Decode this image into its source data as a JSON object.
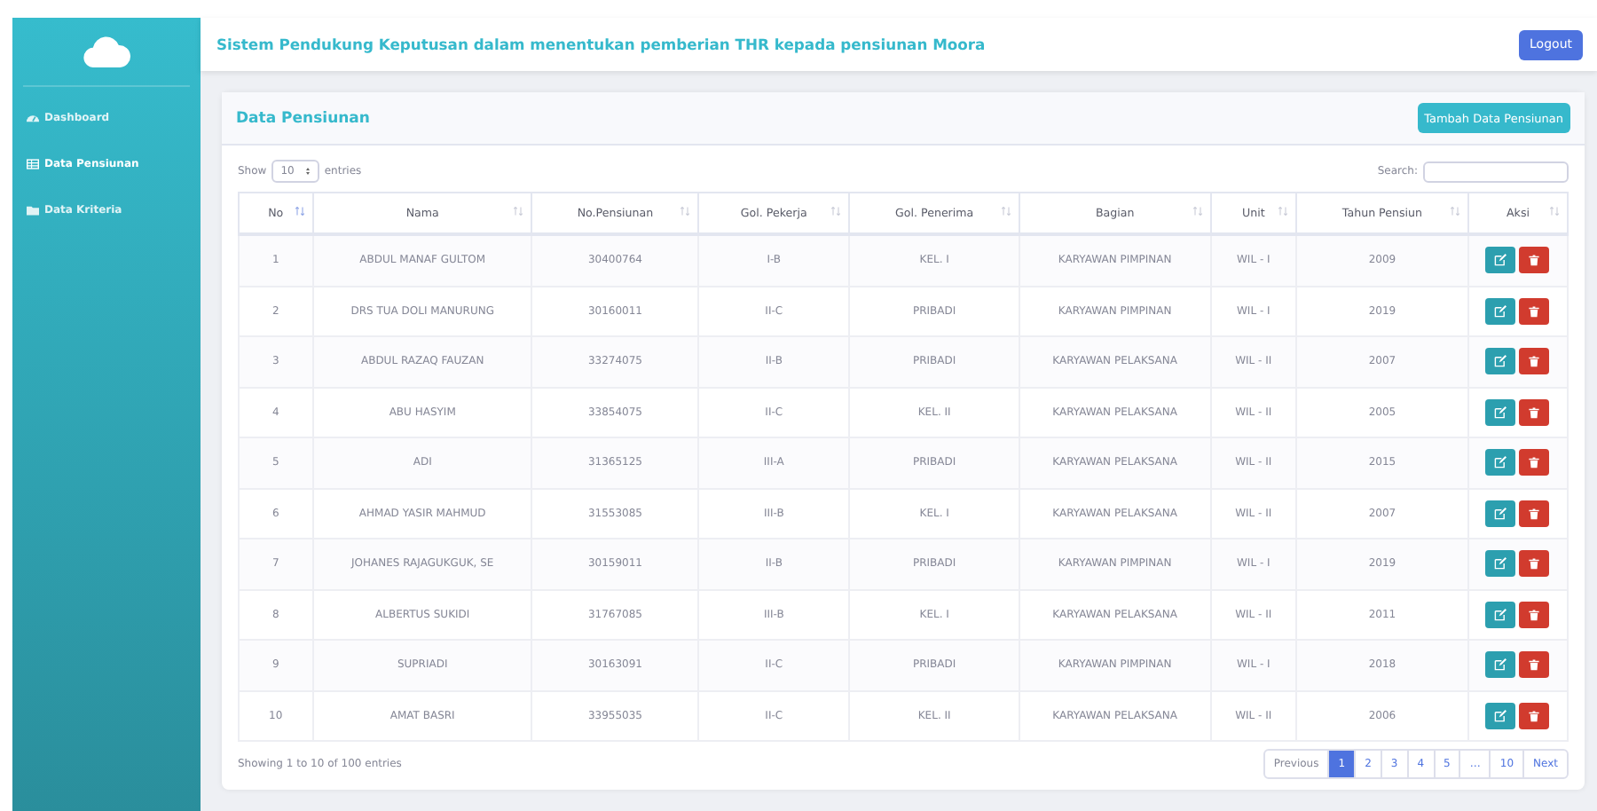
{
  "header": {
    "title": "Sistem Pendukung Keputusan dalam menentukan pemberian THR kepada pensiunan Moora",
    "logout": "Logout"
  },
  "sidebar": {
    "items": [
      {
        "label": "Dashboard",
        "kind": "gauge",
        "selected": false
      },
      {
        "label": "Data Pensiunan",
        "kind": "table",
        "selected": true
      },
      {
        "label": "Data Kriteria",
        "kind": "folder",
        "selected": false
      }
    ]
  },
  "card": {
    "title": "Data Pensiunan",
    "add_button": "Tambah Data Pensiunan"
  },
  "length": {
    "show": "Show",
    "value": "10",
    "entries": "entries"
  },
  "search": {
    "label": "Search:"
  },
  "table": {
    "columns": [
      {
        "label": "No",
        "sorted": true
      },
      {
        "label": "Nama",
        "sorted": false
      },
      {
        "label": "No.Pensiunan",
        "sorted": false
      },
      {
        "label": "Gol. Pekerja",
        "sorted": false
      },
      {
        "label": "Gol. Penerima",
        "sorted": false
      },
      {
        "label": "Bagian",
        "sorted": false
      },
      {
        "label": "Unit",
        "sorted": false
      },
      {
        "label": "Tahun Pensiun",
        "sorted": false
      },
      {
        "label": "Aksi",
        "sorted": false
      }
    ],
    "rows": [
      [
        "1",
        "ABDUL MANAF GULTOM",
        "30400764",
        "I-B",
        "KEL. I",
        "KARYAWAN PIMPINAN",
        "WIL - I",
        "2009"
      ],
      [
        "2",
        "DRS TUA DOLI MANURUNG",
        "30160011",
        "II-C",
        "PRIBADI",
        "KARYAWAN PIMPINAN",
        "WIL - I",
        "2019"
      ],
      [
        "3",
        "ABDUL RAZAQ FAUZAN",
        "33274075",
        "II-B",
        "PRIBADI",
        "KARYAWAN PELAKSANA",
        "WIL - II",
        "2007"
      ],
      [
        "4",
        "ABU HASYIM",
        "33854075",
        "II-C",
        "KEL. II",
        "KARYAWAN PELAKSANA",
        "WIL - II",
        "2005"
      ],
      [
        "5",
        "ADI",
        "31365125",
        "III-A",
        "PRIBADI",
        "KARYAWAN PELAKSANA",
        "WIL - II",
        "2015"
      ],
      [
        "6",
        "AHMAD YASIR MAHMUD",
        "31553085",
        "III-B",
        "KEL. I",
        "KARYAWAN PELAKSANA",
        "WIL - II",
        "2007"
      ],
      [
        "7",
        "JOHANES RAJAGUKGUK, SE",
        "30159011",
        "II-B",
        "PRIBADI",
        "KARYAWAN PIMPINAN",
        "WIL - I",
        "2019"
      ],
      [
        "8",
        "ALBERTUS SUKIDI",
        "31767085",
        "III-B",
        "KEL. I",
        "KARYAWAN PELAKSANA",
        "WIL - II",
        "2011"
      ],
      [
        "9",
        "SUPRIADI",
        "30163091",
        "II-C",
        "PRIBADI",
        "KARYAWAN PIMPINAN",
        "WIL - I",
        "2018"
      ],
      [
        "10",
        "AMAT BASRI",
        "33955035",
        "II-C",
        "KEL. II",
        "KARYAWAN PELAKSANA",
        "WIL - II",
        "2006"
      ]
    ]
  },
  "info": "Showing 1 to 10 of 100 entries",
  "pagination": {
    "previous": "Previous",
    "next": "Next",
    "pages": [
      {
        "label": "1",
        "selected": true
      },
      {
        "label": "2",
        "selected": false
      },
      {
        "label": "3",
        "selected": false
      },
      {
        "label": "4",
        "selected": false
      },
      {
        "label": "5",
        "selected": false
      },
      {
        "label": "…",
        "selected": false
      },
      {
        "label": "10",
        "selected": false
      }
    ]
  }
}
